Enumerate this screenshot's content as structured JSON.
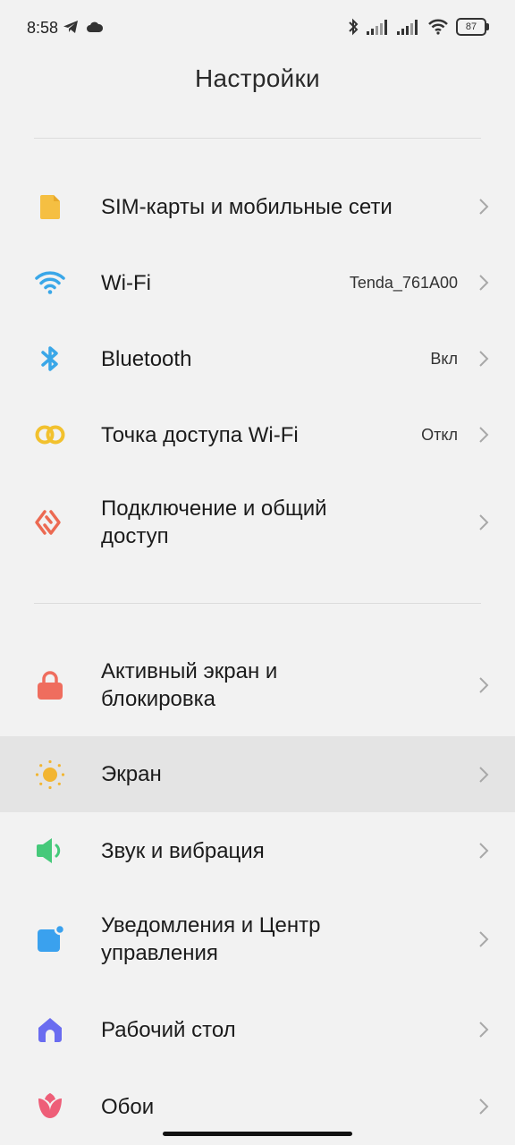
{
  "status_bar": {
    "time": "8:58",
    "battery": "87"
  },
  "title": "Настройки",
  "items": [
    {
      "label": "SIM-карты и мобильные сети",
      "value": "",
      "icon": "sim-card-icon"
    },
    {
      "label": "Wi-Fi",
      "value": "Tenda_761A00",
      "icon": "wifi-icon"
    },
    {
      "label": "Bluetooth",
      "value": "Вкл",
      "icon": "bluetooth-icon"
    },
    {
      "label": "Точка доступа Wi-Fi",
      "value": "Откл",
      "icon": "hotspot-icon"
    },
    {
      "label": "Подключение и общий доступ",
      "value": "",
      "icon": "connection-sharing-icon"
    },
    {
      "label": "Активный экран и блокировка",
      "value": "",
      "icon": "lock-icon"
    },
    {
      "label": "Экран",
      "value": "",
      "icon": "display-sun-icon"
    },
    {
      "label": "Звук и вибрация",
      "value": "",
      "icon": "speaker-icon"
    },
    {
      "label": "Уведомления и Центр управления",
      "value": "",
      "icon": "notification-icon"
    },
    {
      "label": "Рабочий стол",
      "value": "",
      "icon": "home-icon"
    },
    {
      "label": "Обои",
      "value": "",
      "icon": "wallpaper-flower-icon"
    }
  ],
  "colors": {
    "sim": "#f5bf42",
    "wifi": "#3aa7e8",
    "bluetooth": "#3aa7e8",
    "hotspot": "#f2c12e",
    "connection": "#ec6a52",
    "lock": "#ef6d5e",
    "sun": "#f2b531",
    "sound": "#46c97a",
    "notify": "#3aa1ee",
    "home": "#6a6cf0",
    "wallpaper": "#ee5e78"
  }
}
